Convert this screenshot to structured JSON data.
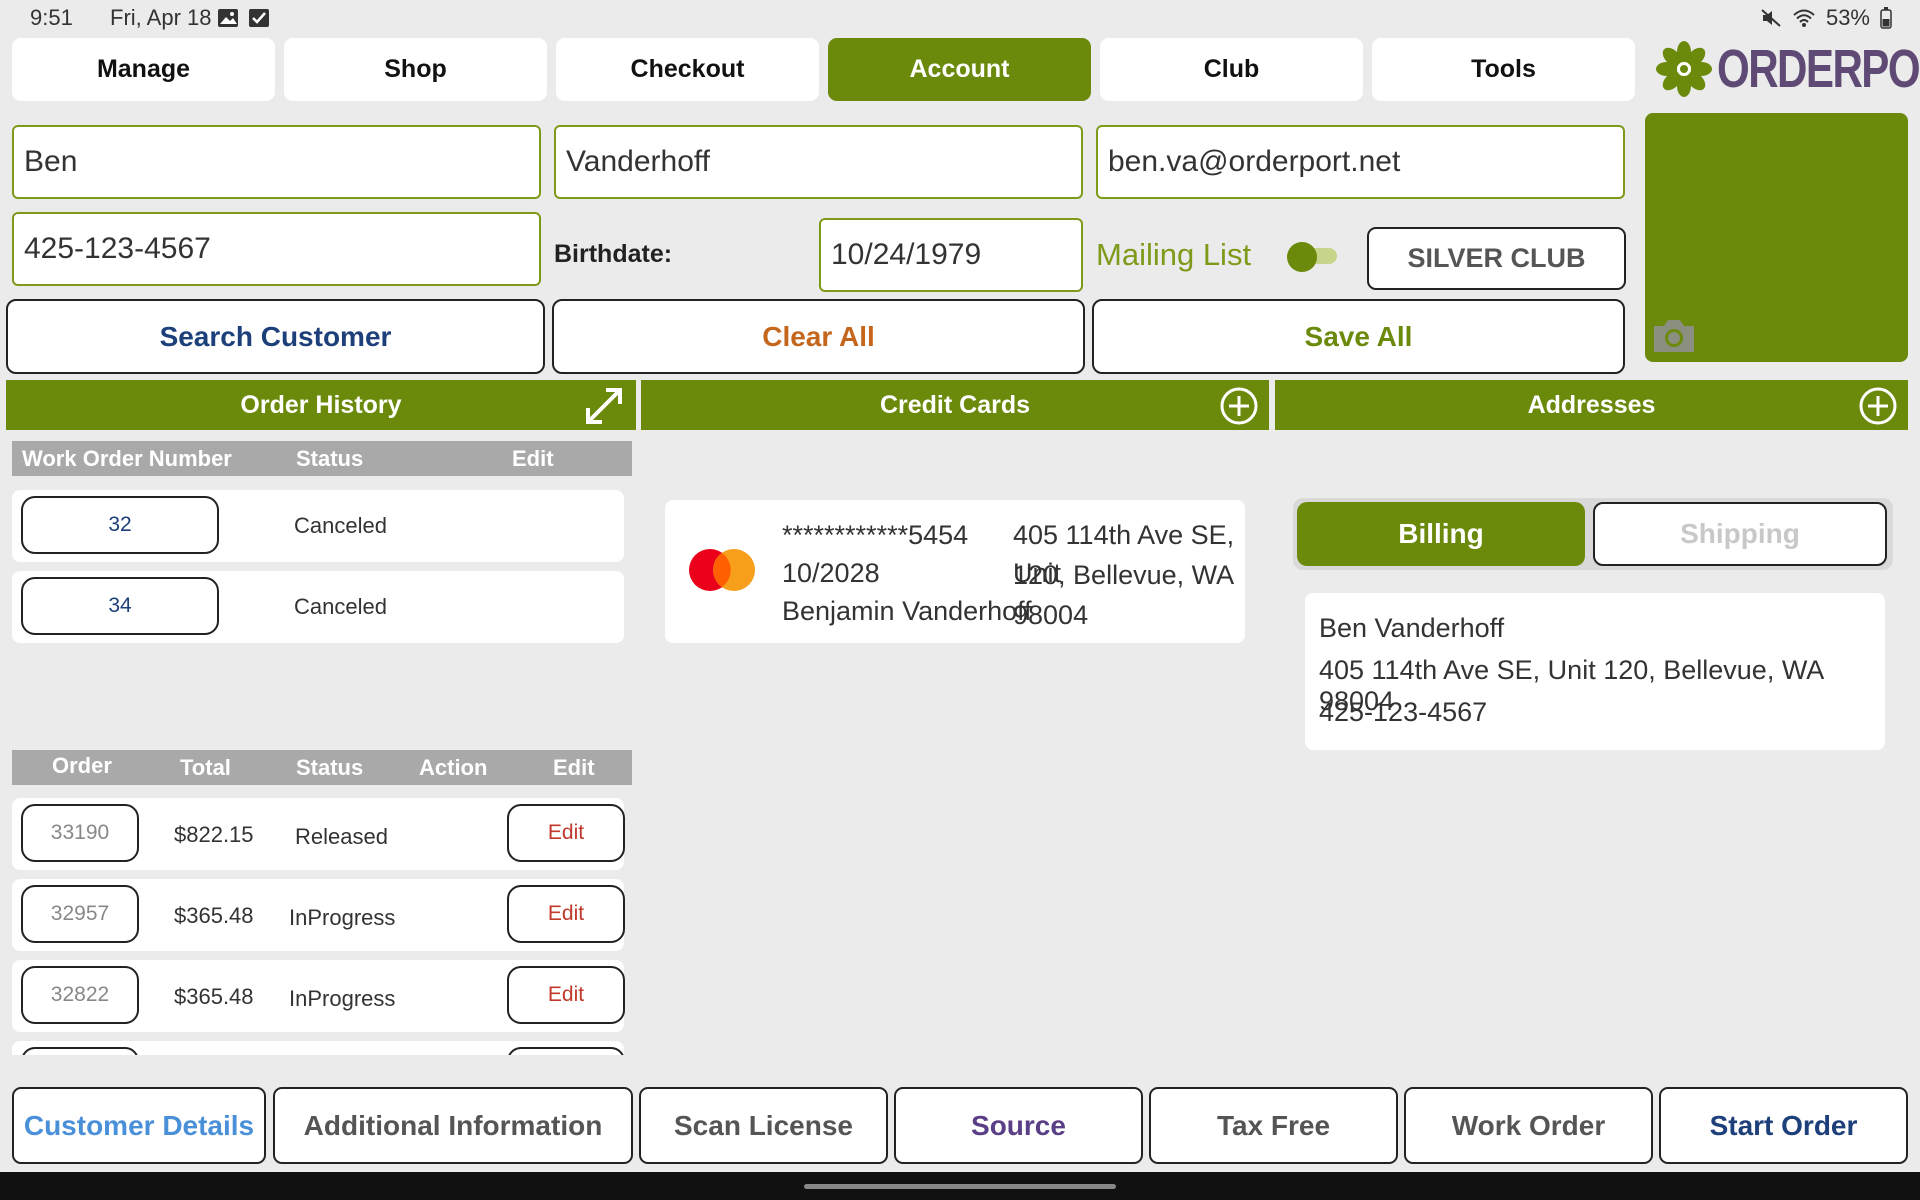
{
  "status_bar": {
    "time": "9:51",
    "date": "Fri, Apr 18",
    "battery": "53%"
  },
  "nav": {
    "tabs": [
      {
        "label": "Manage"
      },
      {
        "label": "Shop"
      },
      {
        "label": "Checkout"
      },
      {
        "label": "Account",
        "active": true
      },
      {
        "label": "Club"
      },
      {
        "label": "Tools"
      }
    ],
    "logo_text": "ORDERPORT"
  },
  "customer": {
    "first_name": "Ben",
    "last_name": "Vanderhoff",
    "email": "ben.va@orderport.net",
    "phone": "425-123-4567",
    "birthdate_label": "Birthdate:",
    "birthdate": "10/24/1979",
    "mailing_list_label": "Mailing List",
    "mailing_list_on": false,
    "club_label": "SILVER CLUB"
  },
  "actions": {
    "search": "Search Customer",
    "clear": "Clear All",
    "save": "Save All"
  },
  "order_history": {
    "title": "Order History",
    "wo_headers": [
      "Work Order Number",
      "Status",
      "Edit"
    ],
    "work_orders": [
      {
        "number": "32",
        "status": "Canceled"
      },
      {
        "number": "34",
        "status": "Canceled"
      }
    ],
    "order_headers": [
      "Order",
      "Total",
      "Status",
      "Action",
      "Edit"
    ],
    "orders": [
      {
        "number": "33190",
        "total": "$822.15",
        "status": "Released",
        "edit": "Edit"
      },
      {
        "number": "32957",
        "total": "$365.48",
        "status": "InProgress",
        "edit": "Edit"
      },
      {
        "number": "32822",
        "total": "$365.48",
        "status": "InProgress",
        "edit": "Edit"
      }
    ]
  },
  "credit_cards": {
    "title": "Credit Cards",
    "cards": [
      {
        "number": "************5454",
        "expiry": "10/2028",
        "name": "Benjamin Vanderhoff",
        "address_line1": "405 114th Ave SE, Unit",
        "address_line2": "120, Bellevue, WA",
        "address_line3": "98004",
        "brand": "mastercard"
      }
    ]
  },
  "addresses": {
    "title": "Addresses",
    "billing_label": "Billing",
    "shipping_label": "Shipping",
    "selected": "Billing",
    "entry": {
      "name": "Ben Vanderhoff",
      "address": "405 114th Ave SE, Unit 120, Bellevue, WA 98004",
      "phone": "425-123-4567"
    }
  },
  "bottom_bar": {
    "customer_details": "Customer Details",
    "additional_information": "Additional Information",
    "scan_license": "Scan License",
    "source": "Source",
    "tax_free": "Tax Free",
    "work_order": "Work Order",
    "start_order": "Start Order"
  },
  "colors": {
    "brand_green": "#6b8a0c",
    "logo_purple": "#5e4a74",
    "search_blue": "#1d3f7a",
    "clear_orange": "#c4661c",
    "save_green": "#6b8a0c",
    "edit_red": "#c0392b"
  }
}
